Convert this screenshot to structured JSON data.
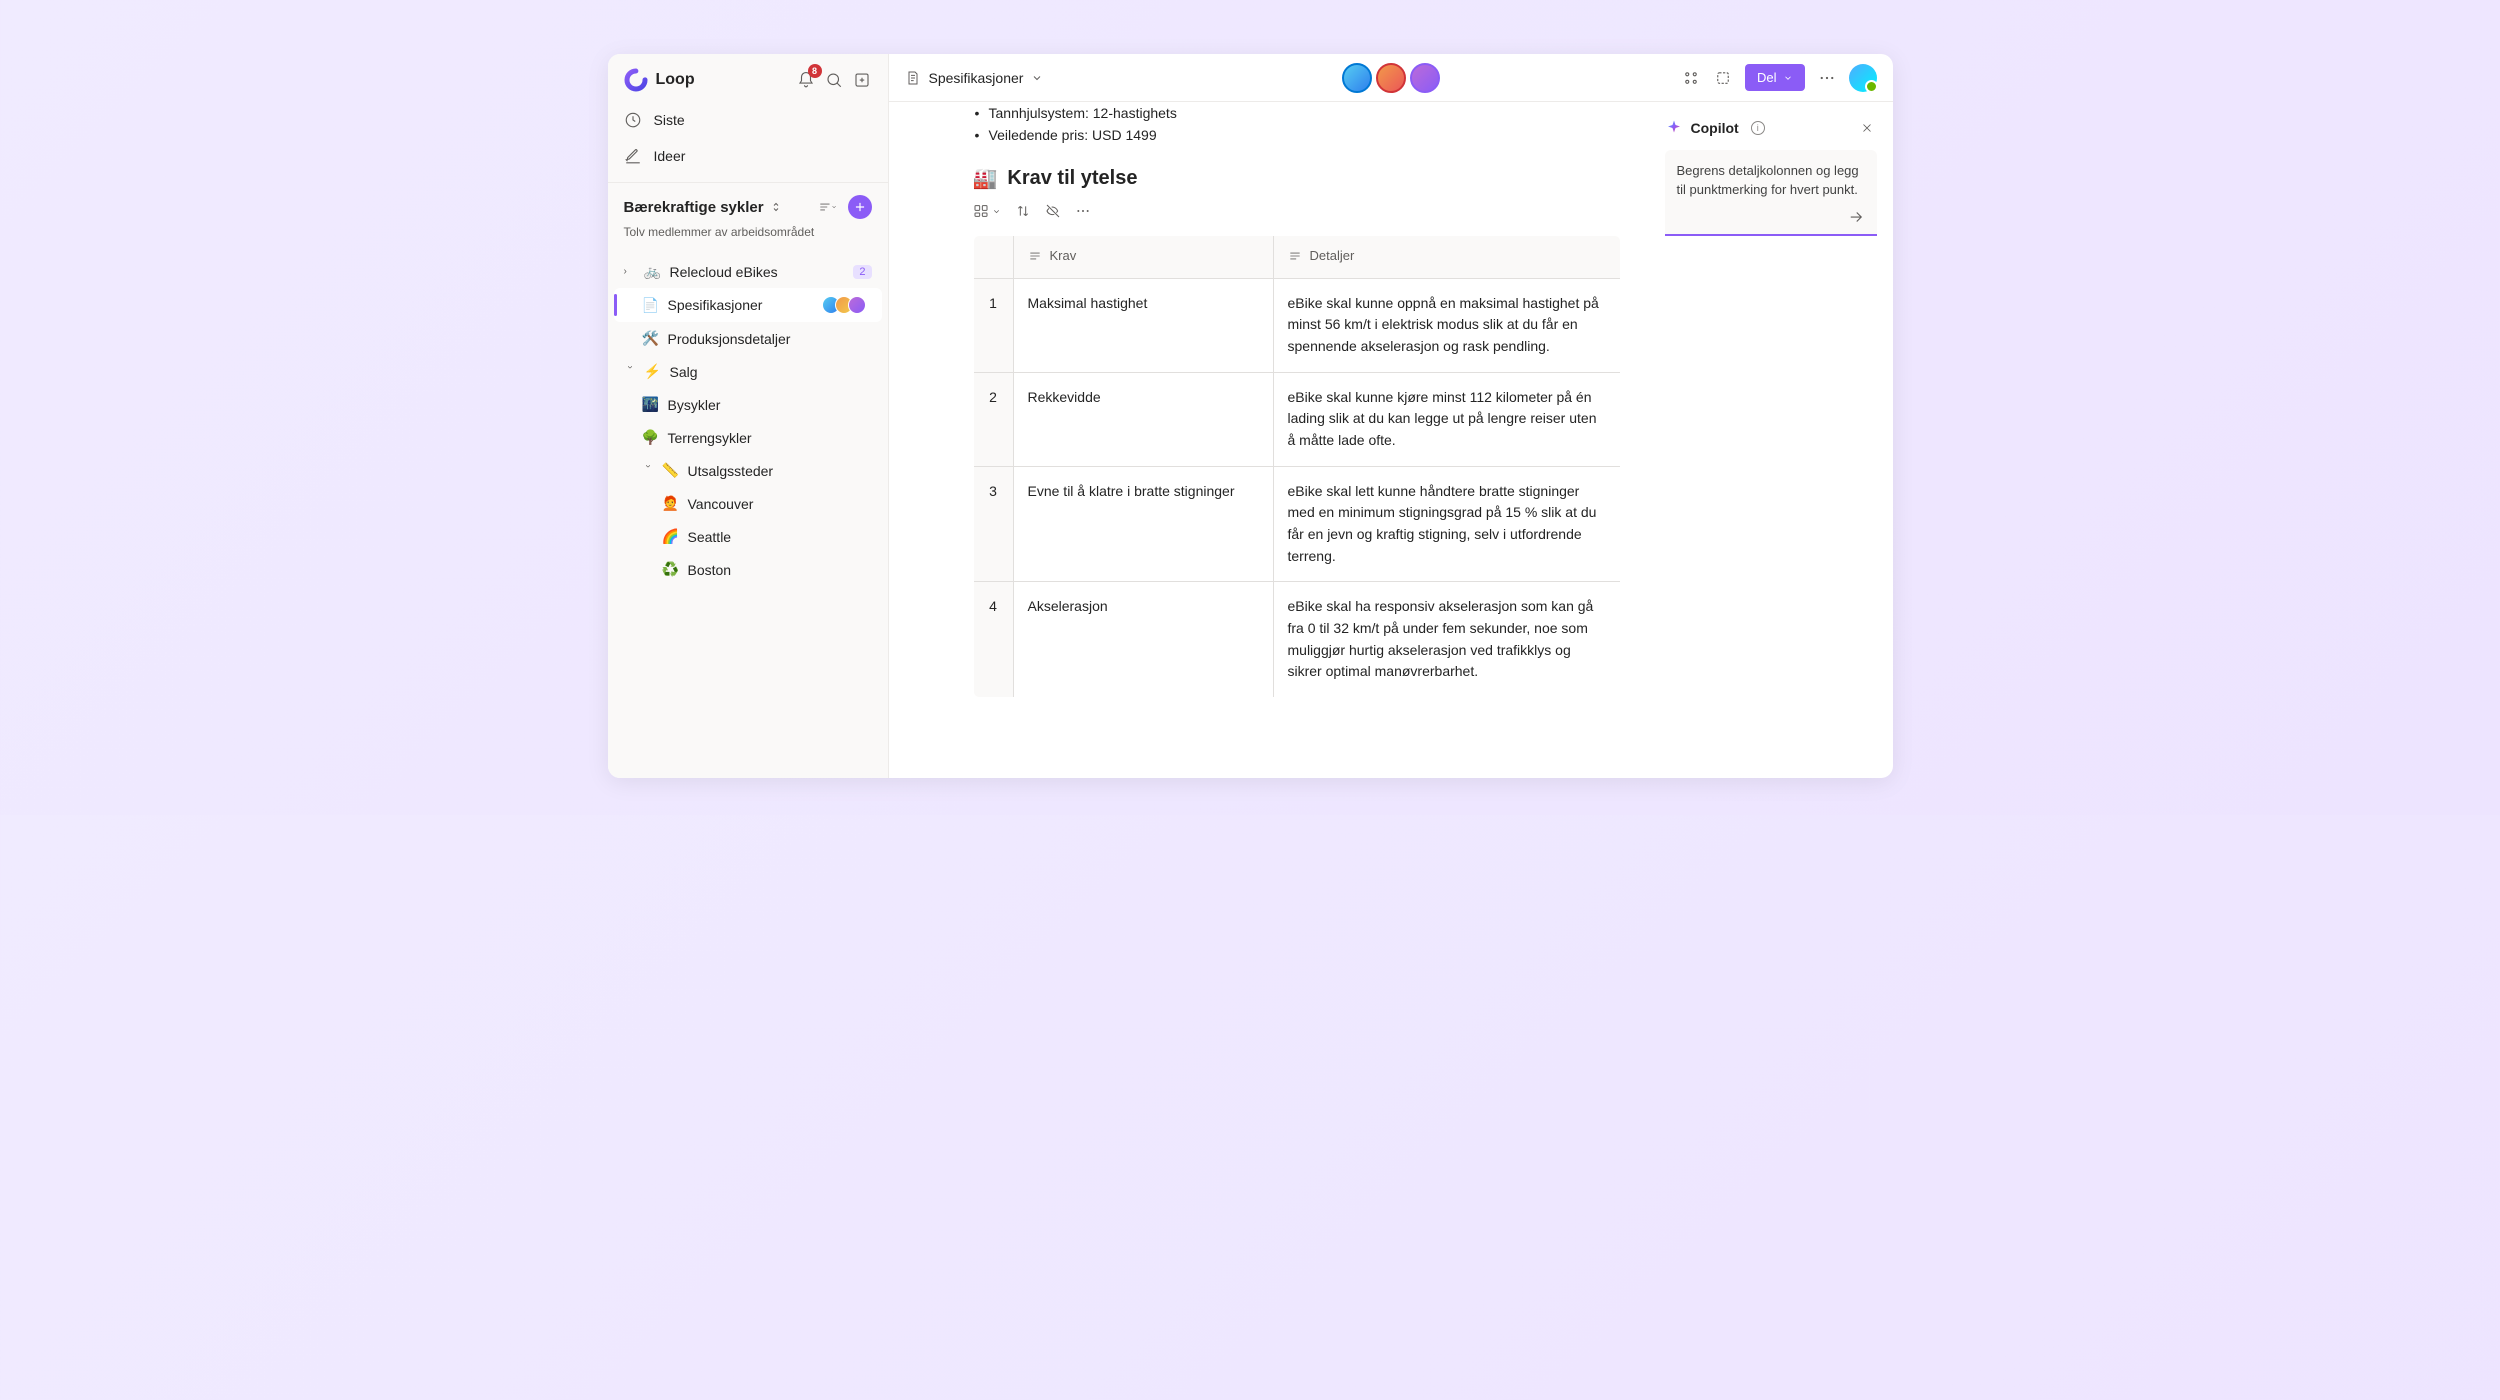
{
  "app": {
    "name": "Loop"
  },
  "notifications": {
    "count": "8"
  },
  "nav": {
    "recent": "Siste",
    "ideas": "Ideer"
  },
  "workspace": {
    "title": "Bærekraftige sykler",
    "subtitle": "Tolv medlemmer av arbeidsområdet"
  },
  "tree": {
    "relecloud": {
      "label": "Relecloud eBikes",
      "badge": "2",
      "emoji": "🚲"
    },
    "spesifikasjoner": {
      "label": "Spesifikasjoner",
      "emoji": "📄"
    },
    "produksjon": {
      "label": "Produksjonsdetaljer",
      "emoji": "🛠️"
    },
    "salg": {
      "label": "Salg",
      "emoji": "⚡"
    },
    "bysykler": {
      "label": "Bysykler",
      "emoji": "🌃"
    },
    "terrengsykler": {
      "label": "Terrengsykler",
      "emoji": "🌳"
    },
    "utsalgssteder": {
      "label": "Utsalgssteder",
      "emoji": "📏"
    },
    "vancouver": {
      "label": "Vancouver",
      "emoji": "🧑‍🦰"
    },
    "seattle": {
      "label": "Seattle",
      "emoji": "🌈"
    },
    "boston": {
      "label": "Boston",
      "emoji": "♻️"
    }
  },
  "breadcrumb": {
    "title": "Spesifikasjoner"
  },
  "share": {
    "label": "Del"
  },
  "document": {
    "bullets": {
      "b1": "Tannhjulsystem: 12-hastighets",
      "b2": "Veiledende pris: USD 1499"
    },
    "heading": {
      "emoji": "🏭",
      "text": "Krav til ytelse"
    },
    "columns": {
      "num": "",
      "krav": "Krav",
      "detaljer": "Detaljer"
    },
    "rows": [
      {
        "num": "1",
        "krav": "Maksimal hastighet",
        "detaljer": "eBike skal kunne oppnå en maksimal hastighet på minst 56 km/t i elektrisk modus slik at du får en spennende akselerasjon og rask pendling."
      },
      {
        "num": "2",
        "krav": "Rekkevidde",
        "detaljer": "eBike skal kunne kjøre minst 112 kilometer på én lading slik at du kan legge ut på lengre reiser uten å måtte lade ofte."
      },
      {
        "num": "3",
        "krav": "Evne til å klatre i bratte stigninger",
        "detaljer": "eBike skal lett kunne håndtere bratte stigninger med en minimum stigningsgrad på 15 % slik at du får en jevn og kraftig stigning, selv i utfordrende terreng."
      },
      {
        "num": "4",
        "krav": "Akselerasjon",
        "detaljer": "eBike skal ha responsiv akselerasjon som kan gå fra 0 til 32 km/t på under fem sekunder, noe som muliggjør hurtig akselerasjon ved trafikklys og sikrer optimal manøvrerbarhet."
      }
    ]
  },
  "copilot": {
    "title": "Copilot",
    "prompt": "Begrens detaljkolonnen og legg til punktmerking for hvert punkt."
  }
}
